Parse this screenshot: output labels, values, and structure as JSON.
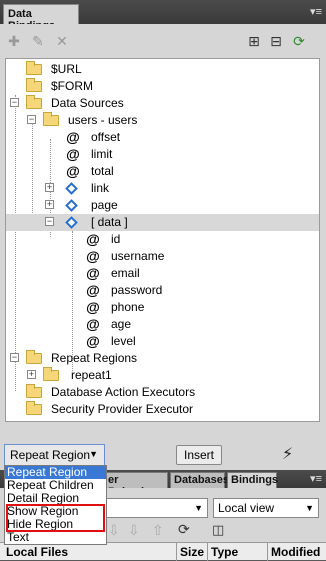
{
  "panel": {
    "title": "Data Bindings",
    "menu_icon": "menu-icon"
  },
  "toolbar": {
    "icons": [
      "plus-icon",
      "pencil-icon",
      "delete-icon",
      "expand-all-icon",
      "collapse-all-icon",
      "refresh-icon"
    ]
  },
  "tree": {
    "url": "$URL",
    "form": "$FORM",
    "data_sources": "Data Sources",
    "users": "users - users",
    "offset": "offset",
    "limit": "limit",
    "total": "total",
    "link": "link",
    "page": "page",
    "data": "[ data ]",
    "id": "id",
    "username": "username",
    "email": "email",
    "password": "password",
    "phone": "phone",
    "age": "age",
    "level": "level",
    "repeat_regions": "Repeat Regions",
    "repeat1": "repeat1",
    "db_action": "Database Action Executors",
    "security": "Security Provider Executor"
  },
  "bottom": {
    "select_value": "Repeat Region",
    "insert_label": "Insert"
  },
  "lower": {
    "tabs": [
      "er Behaviors",
      "Databases",
      "Bindings"
    ],
    "view_select": "Local view",
    "files_headers": [
      "Local Files",
      "Size",
      "Type",
      "Modified"
    ]
  },
  "popup": {
    "items": [
      "Repeat Region",
      "Repeat Children",
      "Detail Region",
      "Show Region",
      "Hide Region",
      "Text"
    ]
  },
  "colors": {
    "selection": "#3a78d6",
    "highlight_box": "#e01010",
    "folder": "#f5d77a"
  }
}
